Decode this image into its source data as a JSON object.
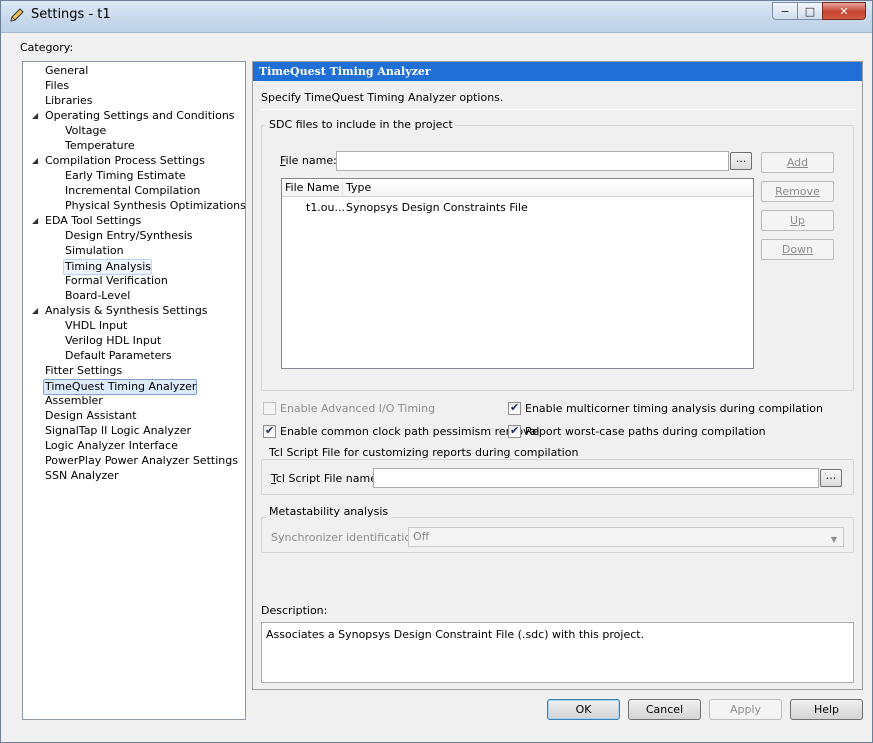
{
  "window": {
    "title": "Settings - t1",
    "minimize": "−",
    "maximize": "□",
    "close": "✕"
  },
  "category_label": "Category:",
  "tree": [
    {
      "label": "General",
      "level": 0
    },
    {
      "label": "Files",
      "level": 0
    },
    {
      "label": "Libraries",
      "level": 0
    },
    {
      "label": "Operating Settings and Conditions",
      "level": 0,
      "expanded": true
    },
    {
      "label": "Voltage",
      "level": 1
    },
    {
      "label": "Temperature",
      "level": 1
    },
    {
      "label": "Compilation Process Settings",
      "level": 0,
      "expanded": true
    },
    {
      "label": "Early Timing Estimate",
      "level": 1
    },
    {
      "label": "Incremental Compilation",
      "level": 1
    },
    {
      "label": "Physical Synthesis Optimizations",
      "level": 1
    },
    {
      "label": "EDA Tool Settings",
      "level": 0,
      "expanded": true
    },
    {
      "label": "Design Entry/Synthesis",
      "level": 1
    },
    {
      "label": "Simulation",
      "level": 1
    },
    {
      "label": "Timing Analysis",
      "level": 1,
      "hover": true
    },
    {
      "label": "Formal Verification",
      "level": 1
    },
    {
      "label": "Board-Level",
      "level": 1
    },
    {
      "label": "Analysis & Synthesis Settings",
      "level": 0,
      "expanded": true
    },
    {
      "label": "VHDL Input",
      "level": 1
    },
    {
      "label": "Verilog HDL Input",
      "level": 1
    },
    {
      "label": "Default Parameters",
      "level": 1
    },
    {
      "label": "Fitter Settings",
      "level": 0
    },
    {
      "label": "TimeQuest Timing Analyzer",
      "level": 0,
      "selected": true
    },
    {
      "label": "Assembler",
      "level": 0
    },
    {
      "label": "Design Assistant",
      "level": 0
    },
    {
      "label": "SignalTap II Logic Analyzer",
      "level": 0
    },
    {
      "label": "Logic Analyzer Interface",
      "level": 0
    },
    {
      "label": "PowerPlay Power Analyzer Settings",
      "level": 0
    },
    {
      "label": "SSN Analyzer",
      "level": 0
    }
  ],
  "panel": {
    "header": "TimeQuest Timing Analyzer",
    "intro": "Specify TimeQuest Timing Analyzer options.",
    "sdc_group": "SDC files to include in the project",
    "file_name_label": "File name:",
    "file_name_value": "",
    "browse_label": "...",
    "columns": [
      "File Name",
      "Type"
    ],
    "rows": [
      {
        "file": "t1.ou...",
        "type": "Synopsys Design Constraints File"
      }
    ],
    "add": "Add",
    "remove": "Remove",
    "up": "Up",
    "down": "Down",
    "enable_advanced_io": "Enable Advanced I/O Timing",
    "enable_multicorner": "Enable multicorner timing analysis during compilation",
    "enable_common_clock": "Enable common clock path pessimism removal",
    "report_worst_case": "Report worst-case paths during compilation",
    "tcl_group": "Tcl Script File for customizing reports during compilation",
    "tcl_label": "Tcl Script File name:",
    "tcl_value": "",
    "tcl_browse": "...",
    "meta_group": "Metastability analysis",
    "sync_label": "Synchronizer identification:",
    "sync_value": "Off",
    "description_label": "Description:",
    "description_text": "Associates a Synopsys Design Constraint File (.sdc) with this project."
  },
  "buttons": {
    "ok": "OK",
    "cancel": "Cancel",
    "apply": "Apply",
    "help": "Help"
  }
}
